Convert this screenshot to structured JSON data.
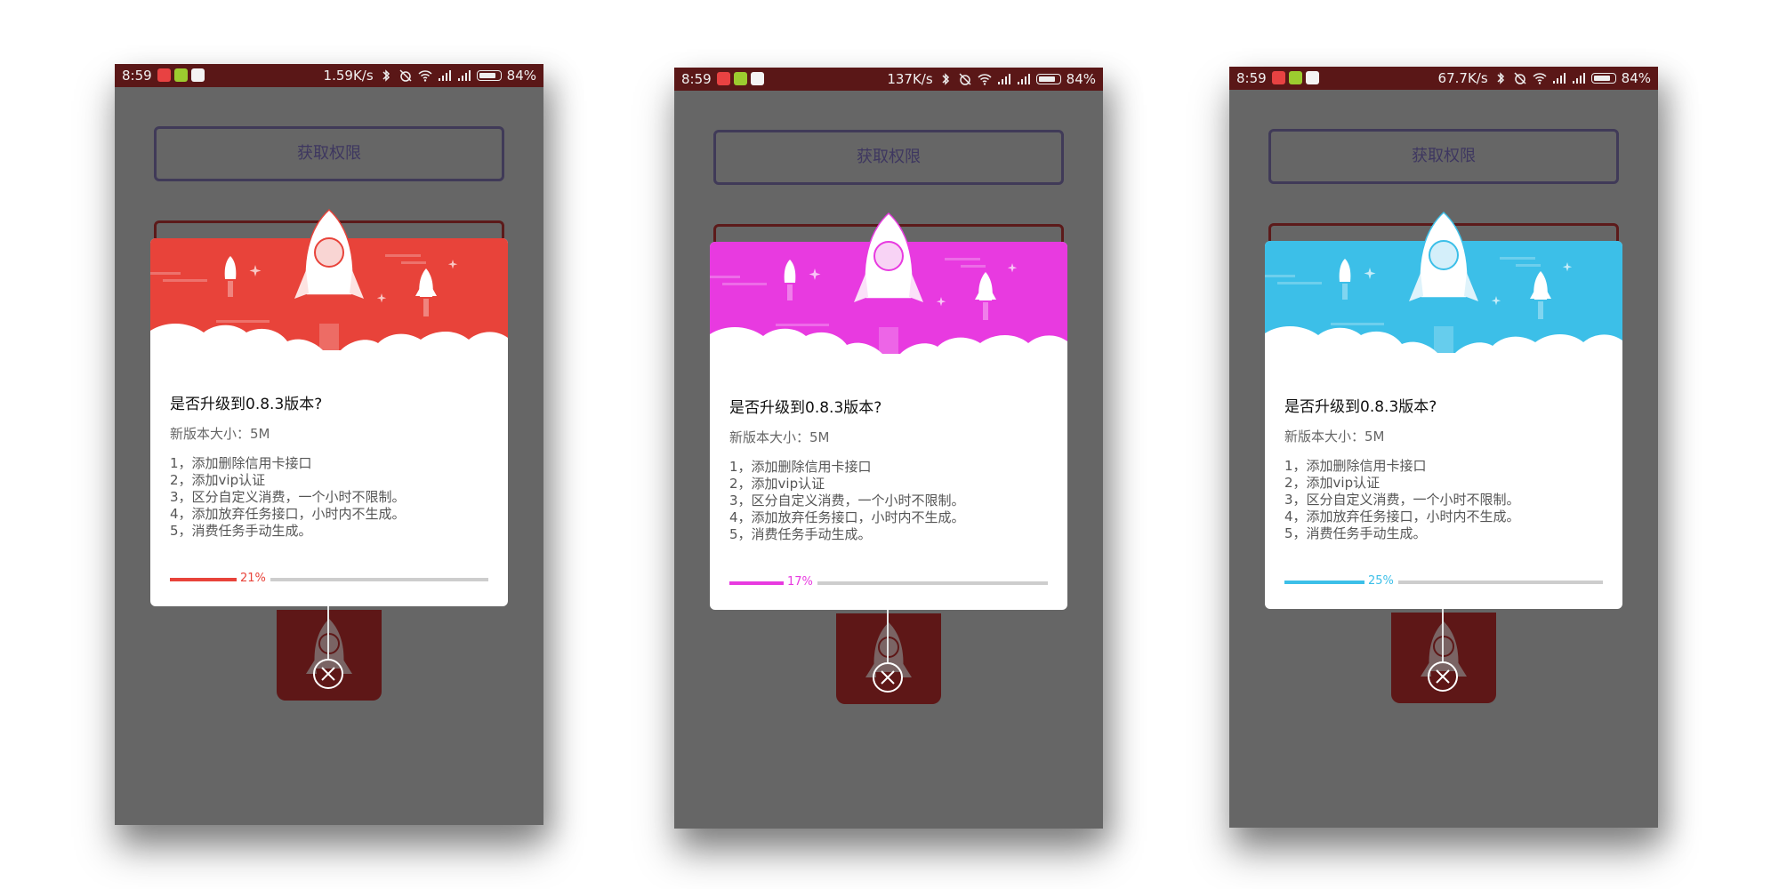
{
  "screens": [
    {
      "theme_color": "#e8433a",
      "status": {
        "time": "8:59",
        "speed": "1.59K/s",
        "battery": "84%"
      },
      "permission_button": "获取权限",
      "dialog": {
        "title": "是否升级到0.8.3版本?",
        "size": "新版本大小：5M",
        "notes": [
          "1，添加删除信用卡接口",
          "2，添加vip认证",
          "3，区分自定义消费，一个小时不限制。",
          "4，添加放弃任务接口，小时内不生成。",
          "5，消费任务手动生成。"
        ],
        "progress_value": 21,
        "progress_label": "21%"
      }
    },
    {
      "theme_color": "#e83ae0",
      "status": {
        "time": "8:59",
        "speed": "137K/s",
        "battery": "84%"
      },
      "permission_button": "获取权限",
      "dialog": {
        "title": "是否升级到0.8.3版本?",
        "size": "新版本大小：5M",
        "notes": [
          "1，添加删除信用卡接口",
          "2，添加vip认证",
          "3，区分自定义消费，一个小时不限制。",
          "4，添加放弃任务接口，小时内不生成。",
          "5，消费任务手动生成。"
        ],
        "progress_value": 17,
        "progress_label": "17%"
      }
    },
    {
      "theme_color": "#3cbfe8",
      "status": {
        "time": "8:59",
        "speed": "67.7K/s",
        "battery": "84%"
      },
      "permission_button": "获取权限",
      "dialog": {
        "title": "是否升级到0.8.3版本?",
        "size": "新版本大小：5M",
        "notes": [
          "1，添加删除信用卡接口",
          "2，添加vip认证",
          "3，区分自定义消费，一个小时不限制。",
          "4，添加放弃任务接口，小时内不生成。",
          "5，消费任务手动生成。"
        ],
        "progress_value": 25,
        "progress_label": "25%"
      }
    }
  ]
}
